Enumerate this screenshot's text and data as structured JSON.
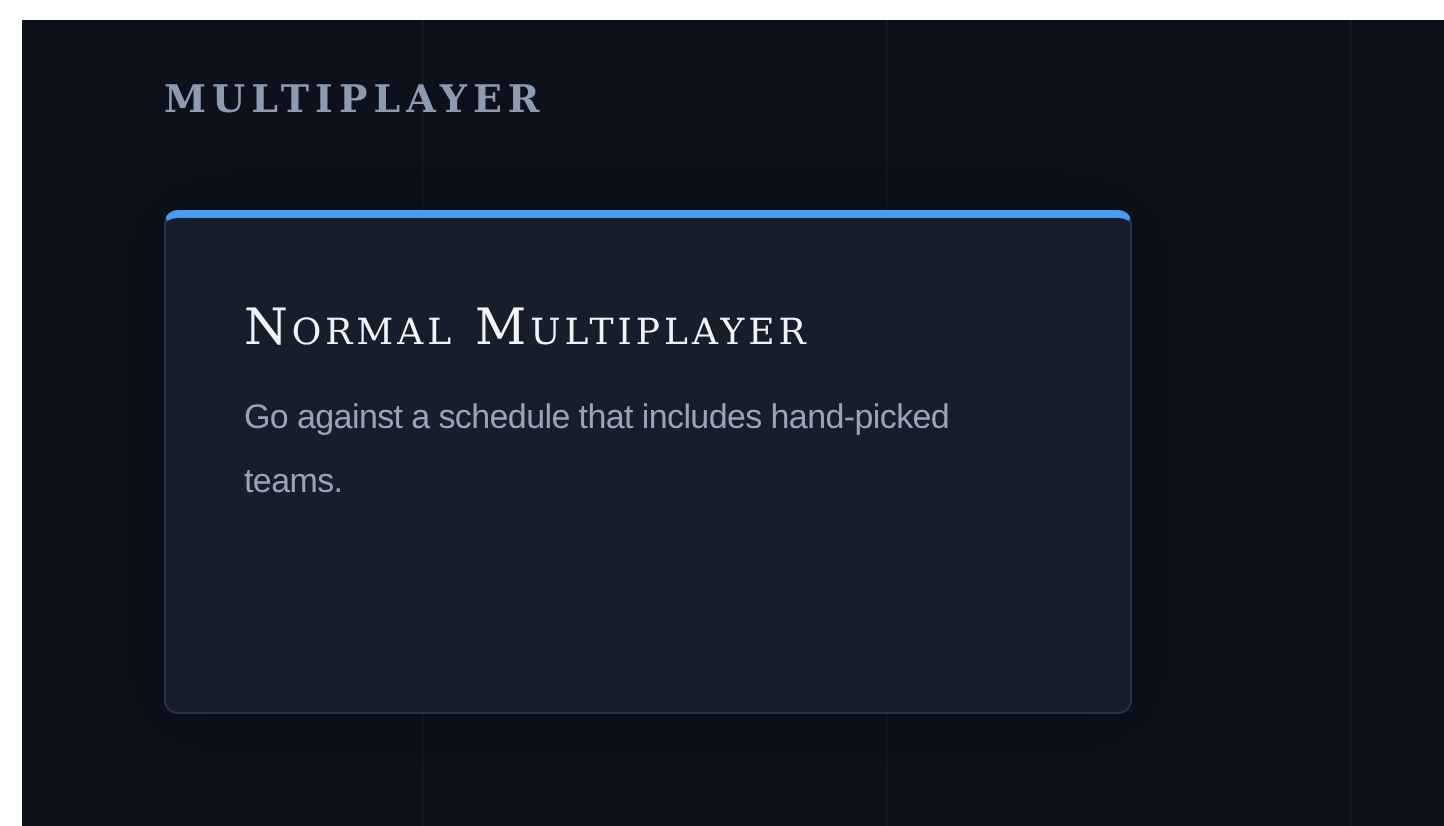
{
  "section": {
    "heading": "MULTIPLAYER"
  },
  "cards": [
    {
      "title": "Normal Multiplayer",
      "description": "Go against a schedule that includes hand-picked teams."
    }
  ]
}
